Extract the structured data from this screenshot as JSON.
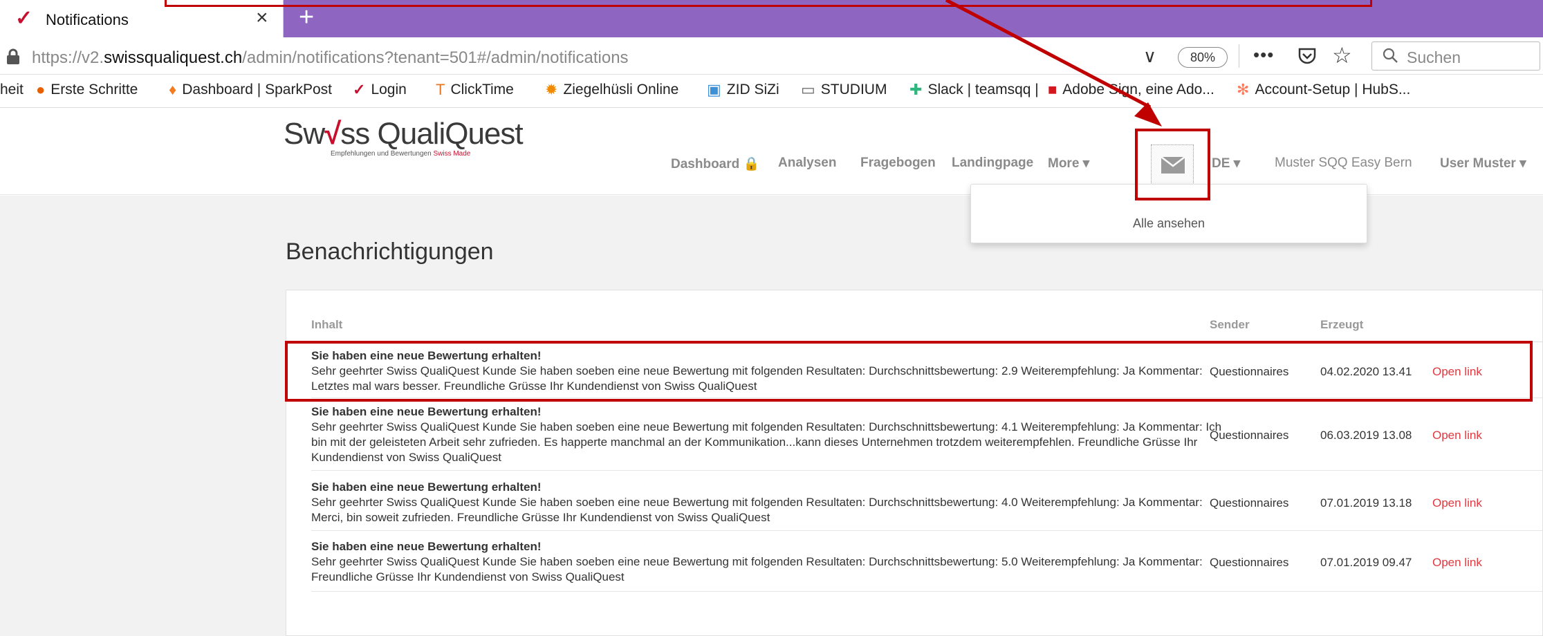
{
  "browser": {
    "tab_title": "Notifications",
    "tab_close": "×",
    "new_tab": "+",
    "url_prefix": "https://v2.",
    "url_domain": "swissqualiquest.ch",
    "url_path": "/admin/notifications?tenant=501#/admin/notifications",
    "url_dropdown": "∨",
    "zoom": "80%",
    "more": "•••",
    "star": "☆",
    "search_placeholder": "Suchen"
  },
  "bookmarks": [
    {
      "label": "heit",
      "icon": ""
    },
    {
      "label": "Erste Schritte",
      "icon": "firefox-icon"
    },
    {
      "label": "Dashboard | SparkPost",
      "icon": "flame-icon"
    },
    {
      "label": "Login",
      "icon": "checkmark-icon"
    },
    {
      "label": "ClickTime",
      "icon": "clicktime-icon"
    },
    {
      "label": "Ziegelhüsli Online",
      "icon": "gear-icon"
    },
    {
      "label": "ZID SiZi",
      "icon": "window-icon"
    },
    {
      "label": "STUDIUM",
      "icon": "folder-icon"
    },
    {
      "label": "Slack | teamsqq |",
      "icon": "slack-icon"
    },
    {
      "label": "Adobe Sign, eine Ado...",
      "icon": "adobe-icon"
    },
    {
      "label": "Account-Setup | HubS...",
      "icon": "hubspot-icon"
    }
  ],
  "logo": {
    "prefix": "Sw",
    "mark": "√",
    "rest": "ss QualiQuest",
    "tagline_a": "Empfehlungen und Bewertungen ",
    "tagline_b": "Swiss Made"
  },
  "nav": {
    "dashboard": "Dashboard 🔒",
    "analysen": "Analysen",
    "fragebogen": "Fragebogen",
    "landingpage": "Landingpage",
    "more": "More ▾",
    "language": "DE ▾",
    "account": "Muster SQQ Easy Bern",
    "user": "User Muster ▾"
  },
  "notif_dropdown": {
    "see_all": "Alle ansehen"
  },
  "page": {
    "title": "Benachrichtigungen"
  },
  "table": {
    "headers": {
      "content": "Inhalt",
      "sender": "Sender",
      "created": "Erzeugt"
    },
    "rows": [
      {
        "title": "Sie haben eine neue Bewertung erhalten!",
        "body": "Sehr geehrter Swiss QualiQuest Kunde Sie haben soeben eine neue Bewertung mit folgenden Resultaten: Durchschnittsbewertung: 2.9 Weiterempfehlung: Ja Kommentar: Letztes mal wars besser. Freundliche Grüsse Ihr Kundendienst von Swiss QualiQuest",
        "sender": "Questionnaires",
        "date": "04.02.2020 13.41",
        "link": "Open link"
      },
      {
        "title": "Sie haben eine neue Bewertung erhalten!",
        "body": "Sehr geehrter Swiss QualiQuest Kunde Sie haben soeben eine neue Bewertung mit folgenden Resultaten: Durchschnittsbewertung: 4.1 Weiterempfehlung: Ja Kommentar: Ich bin mit der geleisteten Arbeit sehr zufrieden. Es happerte manchmal an der Kommunikation...kann dieses Unternehmen trotzdem weiterempfehlen. Freundliche Grüsse Ihr Kundendienst von Swiss QualiQuest",
        "sender": "Questionnaires",
        "date": "06.03.2019 13.08",
        "link": "Open link"
      },
      {
        "title": "Sie haben eine neue Bewertung erhalten!",
        "body": "Sehr geehrter Swiss QualiQuest Kunde Sie haben soeben eine neue Bewertung mit folgenden Resultaten: Durchschnittsbewertung: 4.0 Weiterempfehlung: Ja Kommentar: Merci, bin soweit zufrieden. Freundliche Grüsse Ihr Kundendienst von Swiss QualiQuest",
        "sender": "Questionnaires",
        "date": "07.01.2019 13.18",
        "link": "Open link"
      },
      {
        "title": "Sie haben eine neue Bewertung erhalten!",
        "body": "Sehr geehrter Swiss QualiQuest Kunde Sie haben soeben eine neue Bewertung mit folgenden Resultaten: Durchschnittsbewertung: 5.0 Weiterempfehlung: Ja Kommentar: Freundliche Grüsse Ihr Kundendienst von Swiss QualiQuest",
        "sender": "Questionnaires",
        "date": "07.01.2019 09.47",
        "link": "Open link"
      }
    ]
  },
  "colors": {
    "tabbar": "#8e66c2",
    "brand_red": "#c8102e",
    "link_red": "#e2383f",
    "annotation_red": "#c00000"
  }
}
